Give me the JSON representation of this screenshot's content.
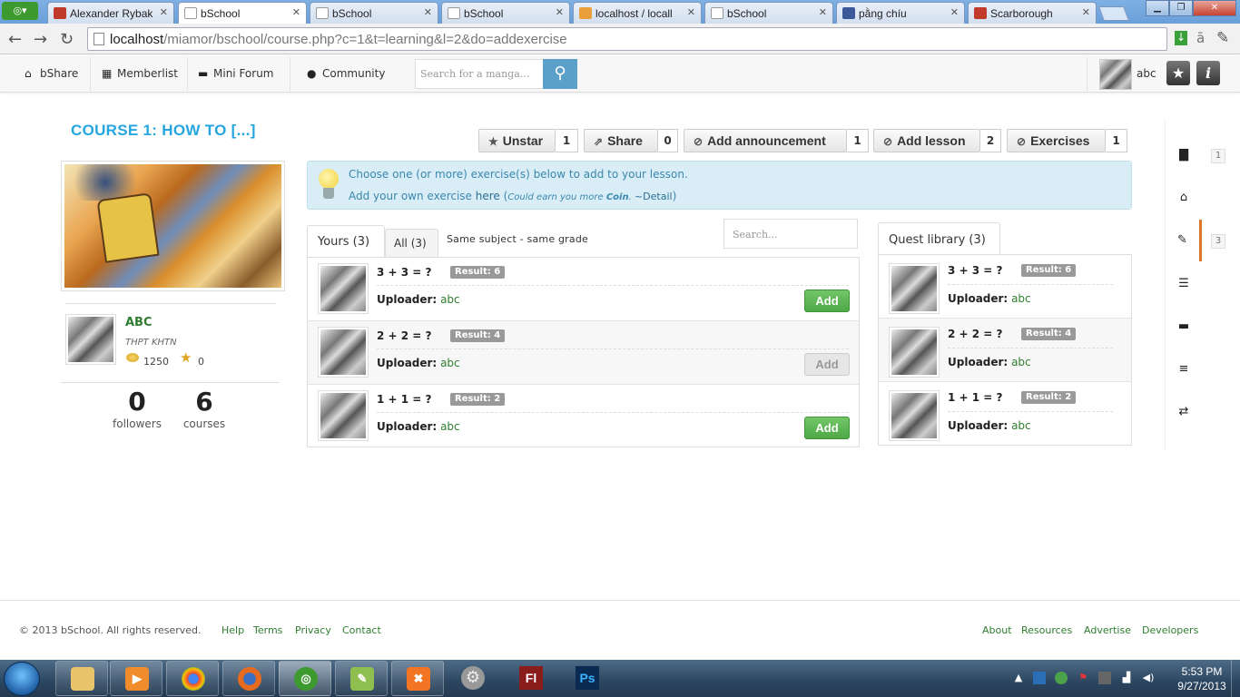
{
  "browser": {
    "tabs": [
      {
        "label": "Alexander Rybak",
        "color": "#c0392b"
      },
      {
        "label": "bSchool",
        "color": "#ffffff"
      },
      {
        "label": "bSchool",
        "color": "#ffffff"
      },
      {
        "label": "bSchool",
        "color": "#ffffff"
      },
      {
        "label": "localhost / locall",
        "color": "#e9a03b"
      },
      {
        "label": "bSchool",
        "color": "#ffffff"
      },
      {
        "label": "pằng chíu",
        "color": "#3b5998"
      },
      {
        "label": "Scarborough",
        "color": "#c0392b"
      }
    ],
    "url_host": "localhost",
    "url_path": "/miamor/bschool/course.php?c=1&t=learning&l=2&do=addexercise"
  },
  "nav": {
    "items": [
      "bShare",
      "Memberlist",
      "Mini Forum",
      "Community"
    ],
    "search_placeholder": "Search for a manga...",
    "username": "abc"
  },
  "course": {
    "title": "COURSE 1: HOW TO [...]",
    "owner_name": "ABC",
    "owner_school": "THPT KHTN",
    "coins": "1250",
    "stars": "0",
    "followers": "0",
    "followers_label": "followers",
    "courses": "6",
    "courses_label": "courses"
  },
  "actions": [
    {
      "label": "Unstar",
      "count": "1",
      "icon": "star-icon"
    },
    {
      "label": "Share",
      "count": "0",
      "icon": "share-icon"
    },
    {
      "label": "Add announcement",
      "count": "1",
      "icon": "check-circle-icon"
    },
    {
      "label": "Add lesson",
      "count": "2",
      "icon": "check-circle-icon"
    },
    {
      "label": "Exercises",
      "count": "1",
      "icon": "check-circle-icon"
    }
  ],
  "alert": {
    "line1": "Choose one (or more) exercise(s) below to add to your lesson.",
    "line2_prefix": "Add your own exercise ",
    "line2_link": "here",
    "line2_paren_open": " (",
    "line2_note": "Could earn you more ",
    "line2_coin": "Coin",
    "line2_after": ". ",
    "line2_detail": "~Detail",
    "line2_close": ")"
  },
  "tabs": {
    "yours": "Yours (3)",
    "all": "All (3)",
    "same": "Same subject - same grade",
    "search_placeholder": "Search...",
    "library": "Quest library (3)"
  },
  "uploader_label": "Uploader:",
  "add_label": "Add",
  "exercises": [
    {
      "question": "3 + 3 = ?",
      "result": "Result: 6",
      "uploader": "abc",
      "added": false
    },
    {
      "question": "2 + 2 = ?",
      "result": "Result: 4",
      "uploader": "abc",
      "added": true
    },
    {
      "question": "1 + 1 = ?",
      "result": "Result: 2",
      "uploader": "abc",
      "added": false
    }
  ],
  "library": [
    {
      "question": "3 + 3 = ?",
      "result": "Result: 6",
      "uploader": "abc"
    },
    {
      "question": "2 + 2 = ?",
      "result": "Result: 4",
      "uploader": "abc"
    },
    {
      "question": "1 + 1 = ?",
      "result": "Result: 2",
      "uploader": "abc"
    }
  ],
  "sidenav": {
    "count_files": "1",
    "count_edit": "3"
  },
  "footer": {
    "copyright": "© 2013 bSchool. All rights reserved.",
    "left_links": [
      "Help",
      "Terms",
      "Privacy",
      "Contact"
    ],
    "right_links": [
      "About",
      "Resources",
      "Advertise",
      "Developers"
    ]
  },
  "taskbar": {
    "time": "5:53 PM",
    "date": "9/27/2013"
  },
  "colors": {
    "accent": "#25a6e0",
    "green": "#2f7d2f",
    "add_button": "#5cb85c",
    "alert_bg": "#d9edf7",
    "active_side": "#d9782c"
  }
}
